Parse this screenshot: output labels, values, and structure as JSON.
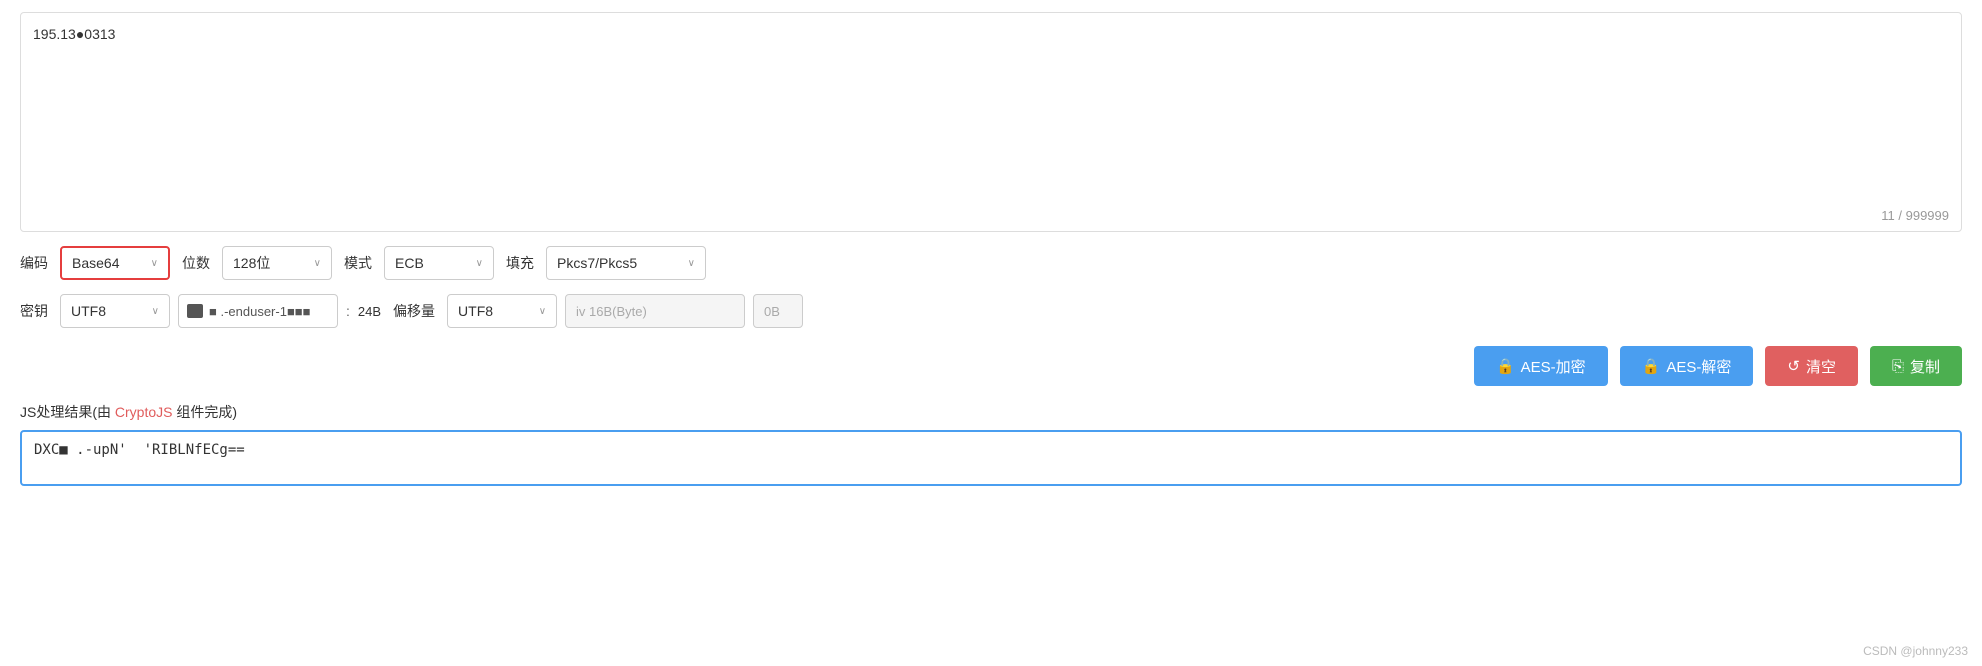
{
  "page": {
    "input_text": "195.13●0313",
    "char_count": "11 / 999999",
    "encoding_label": "编码",
    "encoding_value": "Base64",
    "bits_label": "位数",
    "bits_value": "128位",
    "mode_label": "模式",
    "mode_value": "ECB",
    "fill_label": "填充",
    "fill_value": "Pkcs7/Pkcs5",
    "key_label": "密钥",
    "key_encoding": "UTF8",
    "key_masked": "■ .-enduser-1■■■",
    "key_colon": ":",
    "key_size": "24B",
    "offset_label": "偏移量",
    "offset_encoding": "UTF8",
    "iv_placeholder": "iv 16B(Byte)",
    "iv_size": "0B",
    "btn_encrypt": "🔒 AES-加密",
    "btn_decrypt": "🔒 AES-解密",
    "btn_clear": "↺ 清空",
    "btn_copy": "⎘ 复制",
    "result_label_prefix": "JS处理结果(由 ",
    "result_cryptojs": "CryptoJS",
    "result_label_suffix": " 组件完成)",
    "result_value": "DXC■ .-upN'  'RIBLNfECg==",
    "watermark": "CSDN @johnny233"
  }
}
